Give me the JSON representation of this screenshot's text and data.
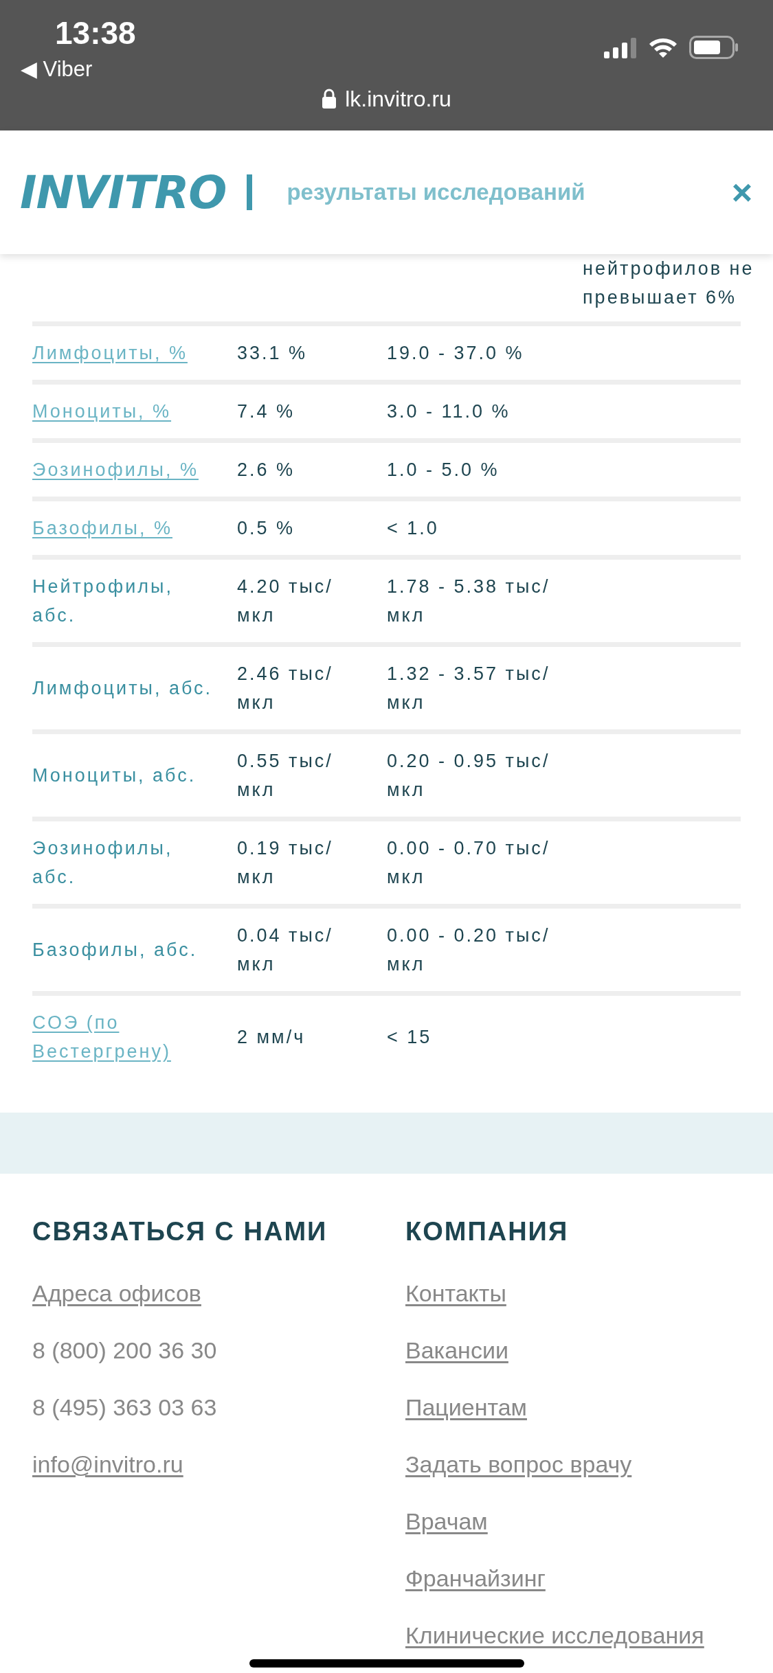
{
  "status_bar": {
    "time": "13:38",
    "back_app": "◀ Viber",
    "url": "lk.invitro.ru"
  },
  "header": {
    "logo": "INVITRO",
    "title": "результаты исследований",
    "close": "×"
  },
  "partial_note": [
    "нейтрофилов не",
    "превышает 6%"
  ],
  "table": {
    "rows": [
      {
        "name": "Лимфоциты, %",
        "kind": "link",
        "value": "33.1 %",
        "range": "19.0 - 37.0 %"
      },
      {
        "name": "Моноциты, %",
        "kind": "link",
        "value": "7.4 %",
        "range": "3.0 - 11.0 %"
      },
      {
        "name": "Эозинофилы, %",
        "kind": "link",
        "value": "2.6 %",
        "range": "1.0 - 5.0 %"
      },
      {
        "name": "Базофилы, %",
        "kind": "link",
        "value": "0.5 %",
        "range": "< 1.0"
      },
      {
        "name": "Нейтрофилы, абс.",
        "kind": "plain",
        "value": "4.20 тыс/мкл",
        "range": "1.78 - 5.38 тыс/мкл"
      },
      {
        "name": "Лимфоциты, абс.",
        "kind": "plain",
        "value": "2.46 тыс/мкл",
        "range": "1.32 - 3.57 тыс/мкл"
      },
      {
        "name": "Моноциты, абс.",
        "kind": "plain",
        "value": "0.55 тыс/мкл",
        "range": "0.20 - 0.95 тыс/мкл"
      },
      {
        "name": "Эозинофилы, абс.",
        "kind": "plain",
        "value": "0.19 тыс/мкл",
        "range": "0.00 - 0.70 тыс/мкл"
      },
      {
        "name": "Базофилы, абс.",
        "kind": "plain",
        "value": "0.04 тыс/мкл",
        "range": "0.00 - 0.20 тыс/мкл"
      },
      {
        "name": "СОЭ (по Вестергрену)",
        "kind": "link",
        "value": "2 мм/ч",
        "range": "< 15"
      }
    ]
  },
  "footer": {
    "contact": {
      "heading": "СВЯЗАТЬСЯ С НАМИ",
      "items": [
        {
          "text": "Адреса офисов",
          "kind": "link"
        },
        {
          "text": "8 (800) 200 36 30",
          "kind": "plain"
        },
        {
          "text": "8 (495) 363 03 63",
          "kind": "plain"
        },
        {
          "text": "info@invitro.ru",
          "kind": "link"
        }
      ]
    },
    "company": {
      "heading": "КОМПАНИЯ",
      "items": [
        "Контакты",
        "Вакансии",
        "Пациентам",
        "Задать вопрос врачу",
        "Врачам",
        "Франчайзинг",
        "Клинические исследования"
      ]
    }
  }
}
